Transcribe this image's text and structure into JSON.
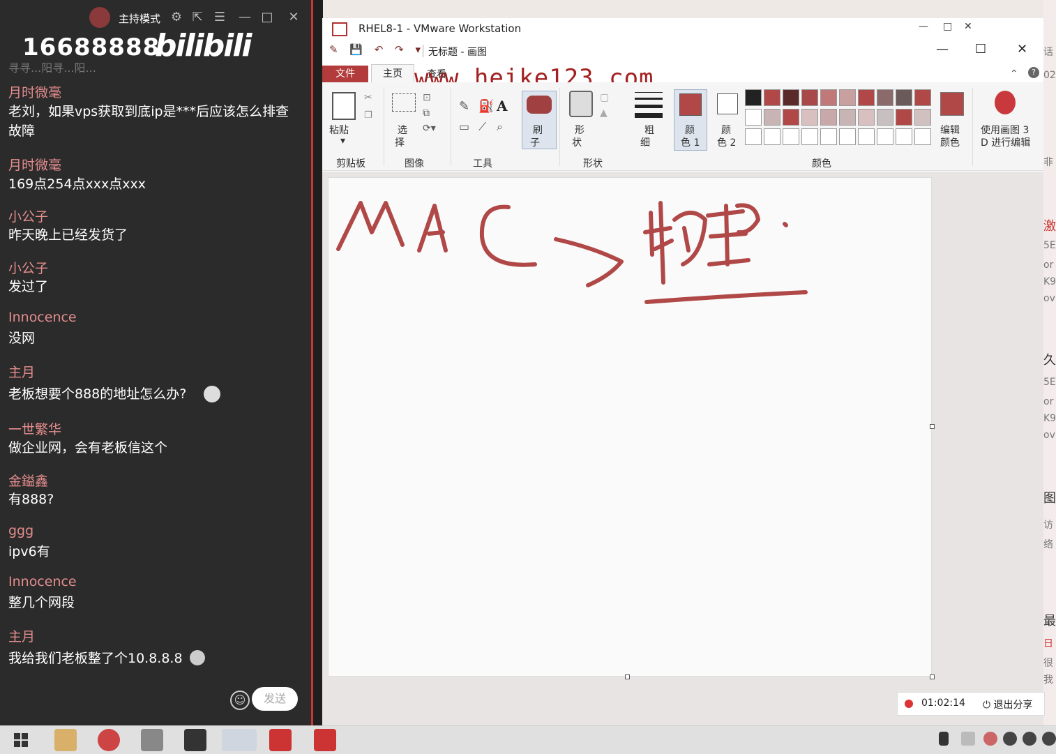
{
  "chat": {
    "host_mode": "主持模式",
    "room_number": "16688888",
    "logo": "bilibili",
    "previous_fragment": "寻寻...阳寻...阳...",
    "messages": [
      {
        "user": "月时微毫",
        "text": "老刘，如果vps获取到底ip是***后应该怎么排查故障"
      },
      {
        "user": "月时微毫",
        "text": "169点254点xxx点xxx"
      },
      {
        "user": "小公子",
        "text": "昨天晚上已经发货了"
      },
      {
        "user": "小公子",
        "text": "发过了"
      },
      {
        "user": "Innocence",
        "text": "没网"
      },
      {
        "user": "主月",
        "text": "老板想要个888的地址怎么办?"
      },
      {
        "user": "一世繁华",
        "text": "做企业网，会有老板信这个"
      },
      {
        "user": "金鎰鑫",
        "text": "有888?"
      },
      {
        "user": "ggg",
        "text": "ipv6有"
      },
      {
        "user": "Innocence",
        "text": "整几个网段"
      },
      {
        "user": "主月",
        "text": "我给我们老板整了个10.8.8.8"
      }
    ],
    "send_label": "发送",
    "icons": [
      "settings-icon",
      "popout-icon",
      "menu-icon",
      "minimize-icon",
      "maximize-icon",
      "close-icon",
      "emoji-icon"
    ]
  },
  "vmware": {
    "title": "RHEL8-1 - VMware Workstation",
    "controls": [
      "—",
      "□",
      "✕"
    ]
  },
  "paint": {
    "title": "无标题 - 画图",
    "tabs": {
      "file": "文件",
      "home": "主页",
      "view": "查看"
    },
    "watermark": "www.heike123.com",
    "ribbon": {
      "paste": "粘贴",
      "select_1": "选",
      "select_2": "择",
      "brush_1": "刷",
      "brush_2": "子",
      "shape_1": "形",
      "shape_2": "状",
      "size_1": "粗",
      "size_2": "细",
      "color1_1": "颜",
      "color1_2": "色 1",
      "color2_1": "颜",
      "color2_2": "色 2",
      "edit_colors_1": "编辑",
      "edit_colors_2": "颜色",
      "paint3d_1": "使用画图 3",
      "paint3d_2": "D 进行编辑"
    },
    "groups": {
      "clipboard": "剪贴板",
      "image": "图像",
      "tools": "工具",
      "shapes": "形状",
      "colors": "颜色"
    },
    "palette_row1": [
      "#222222",
      "#b04848",
      "#5a2a2a",
      "#a84848",
      "#c07878",
      "#c8a0a0",
      "#b04848",
      "#8a6a6a",
      "#6a5a5a",
      "#b04848"
    ],
    "palette_row2": [
      "#ffffff",
      "#c8b4b4",
      "#b04848",
      "#d8c0c0",
      "#c8a8a8",
      "#c8b4b4",
      "#d8c0c0",
      "#c8c0c0",
      "#b04848",
      "#d0c0c0"
    ],
    "color1": "#b04848",
    "color2": "#ffffff"
  },
  "recording": {
    "time": "01:02:14",
    "exit_label": "退出分享"
  }
}
